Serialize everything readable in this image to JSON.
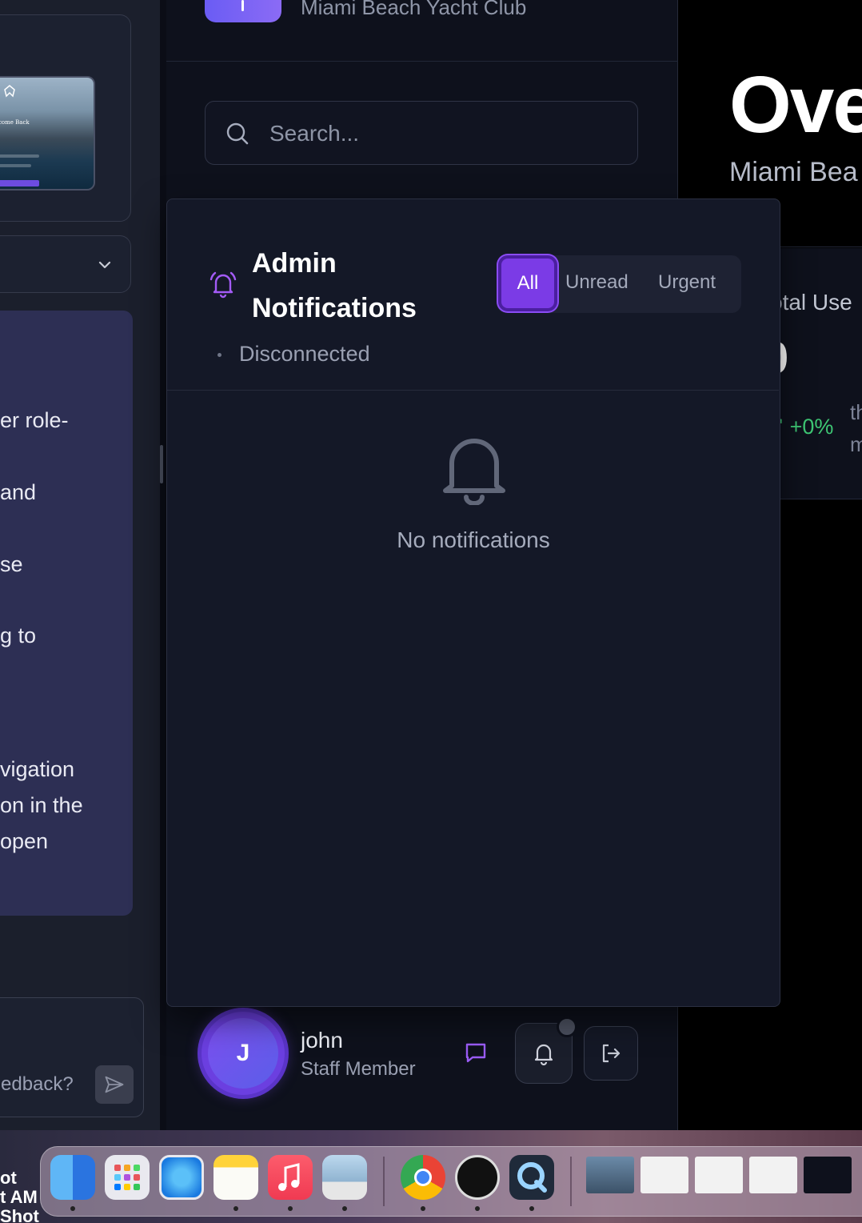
{
  "club": {
    "name": "Miami Beach Yacht Club"
  },
  "search": {
    "placeholder": "Search..."
  },
  "chat_panel": {
    "preview_text": "Welcome Back",
    "message_lines": [
      "er role-",
      "and",
      "se",
      "g to",
      "vigation",
      "on in the",
      "open"
    ],
    "feedback_placeholder": "edback?"
  },
  "notifications": {
    "title": "Admin Notifications",
    "connection_status": "Disconnected",
    "filters": [
      "All",
      "Unread",
      "Urgent"
    ],
    "active_filter": "All",
    "empty_message": "No notifications"
  },
  "user": {
    "initial": "J",
    "name": "john",
    "role": "Staff Member"
  },
  "overview": {
    "title": "Ove",
    "subtitle": "Miami Bea",
    "stat_label": "otal Use",
    "stat_value": "0",
    "stat_change": "+0%",
    "stat_note_1": "th",
    "stat_note_2": "m"
  },
  "desktop": {
    "text": "ot\nt AM\nShot"
  },
  "colors": {
    "accent": "#7b3be6",
    "success": "#3ec774",
    "background": "#0e111c"
  },
  "dock": {
    "apps": [
      "finder-icon",
      "launchpad-icon",
      "safari-icon",
      "notes-icon",
      "music-icon",
      "preview-icon",
      "chrome-icon",
      "instruments-icon",
      "quicktime-icon"
    ]
  }
}
